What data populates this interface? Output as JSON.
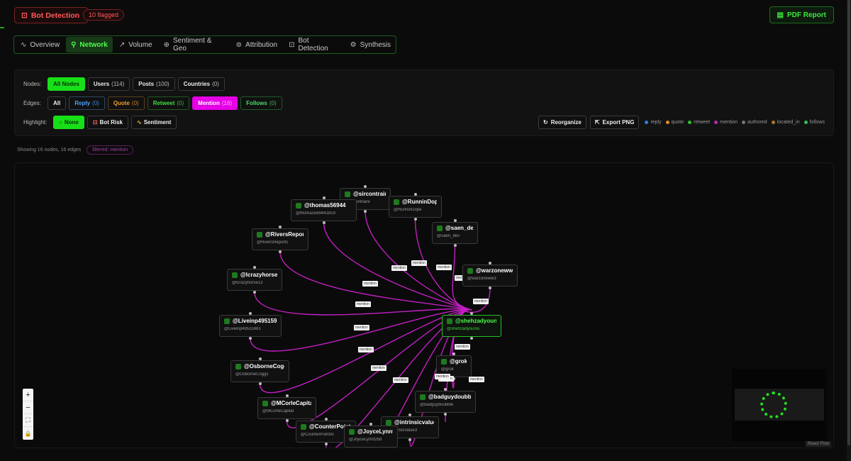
{
  "header": {
    "bot_button": "Bot Detection",
    "flag_badge": "10 flagged",
    "pdf_button": "PDF Report"
  },
  "tabs": [
    {
      "label": "Overview",
      "icon": "pulse-icon"
    },
    {
      "label": "Network",
      "icon": "network-icon"
    },
    {
      "label": "Volume",
      "icon": "trend-icon"
    },
    {
      "label": "Sentiment & Geo",
      "icon": "globe-icon"
    },
    {
      "label": "Attribution",
      "icon": "fingerprint-icon"
    },
    {
      "label": "Bot Detection",
      "icon": "bot-icon"
    },
    {
      "label": "Synthesis",
      "icon": "sparkle-icon"
    }
  ],
  "filters": {
    "nodes_label": "Nodes:",
    "nodes": [
      {
        "label": "All Nodes",
        "count": ""
      },
      {
        "label": "Users",
        "count": "(114)"
      },
      {
        "label": "Posts",
        "count": "(100)"
      },
      {
        "label": "Countries",
        "count": "(0)"
      }
    ],
    "edges_label": "Edges:",
    "edges": [
      {
        "label": "All",
        "count": ""
      },
      {
        "label": "Reply",
        "count": "(0)"
      },
      {
        "label": "Quote",
        "count": "(0)"
      },
      {
        "label": "Retweet",
        "count": "(0)"
      },
      {
        "label": "Mention",
        "count": "(16)"
      },
      {
        "label": "Follows",
        "count": "(0)"
      }
    ],
    "highlight_label": "Highlight:",
    "highlight": [
      {
        "label": "None"
      },
      {
        "label": "Bot Risk"
      },
      {
        "label": "Sentiment"
      }
    ]
  },
  "tools": {
    "reorganize": "Reorganize",
    "export": "Export PNG"
  },
  "legend": [
    {
      "label": "reply",
      "color": "#2f7fd8"
    },
    {
      "label": "quote",
      "color": "#d88a2f"
    },
    {
      "label": "retweet",
      "color": "#2fbf2f"
    },
    {
      "label": "mention",
      "color": "#b02fb0"
    },
    {
      "label": "authored",
      "color": "#777777"
    },
    {
      "label": "located_in",
      "color": "#b07a2f"
    },
    {
      "label": "follows",
      "color": "#2fbf5a"
    }
  ],
  "status": {
    "showing": "Showing 16 nodes, 16 edges",
    "filtered": "filtered: mention"
  },
  "graph": {
    "hub": {
      "name": "@shehzadyounis",
      "handle": "@shehzadyounis"
    },
    "nodes": [
      {
        "name": "@sircontraire",
        "handle": "@sircontraire"
      },
      {
        "name": "@thomas56944",
        "handle": "@thomas569441819"
      },
      {
        "name": "@RunninDope",
        "handle": "@RunninDope"
      },
      {
        "name": "@saen_dev",
        "handle": "@saen_dev"
      },
      {
        "name": "@RiversReports",
        "handle": "@RiversReports"
      },
      {
        "name": "@warzoneww3",
        "handle": "@warzoneww3"
      },
      {
        "name": "@lcrazyhorse13",
        "handle": "@lcrazyhorse13"
      },
      {
        "name": "@Liveinp49515981",
        "handle": "@Liveinp49515981"
      },
      {
        "name": "@grok",
        "handle": "@grok"
      },
      {
        "name": "@OsborneCoggs",
        "handle": "@OsborneCoggs"
      },
      {
        "name": "@badguydoubble",
        "handle": "@badguydoubble"
      },
      {
        "name": "@MCorleCapital",
        "handle": "@MCorleCapital"
      },
      {
        "name": "@intrinsicvalue3",
        "handle": "@intrinsicvalue3"
      },
      {
        "name": "@CounterPointAI",
        "handle": "@CounterPointAI"
      },
      {
        "name": "@JoyceLynnt2bd",
        "handle": "@JoyceLynnt2bd"
      }
    ],
    "edge_label": "mention"
  },
  "controls": {
    "zoom_in": "+",
    "zoom_out": "−",
    "fit": "⛶",
    "lock": "🔒"
  },
  "attribution": "React Flow"
}
